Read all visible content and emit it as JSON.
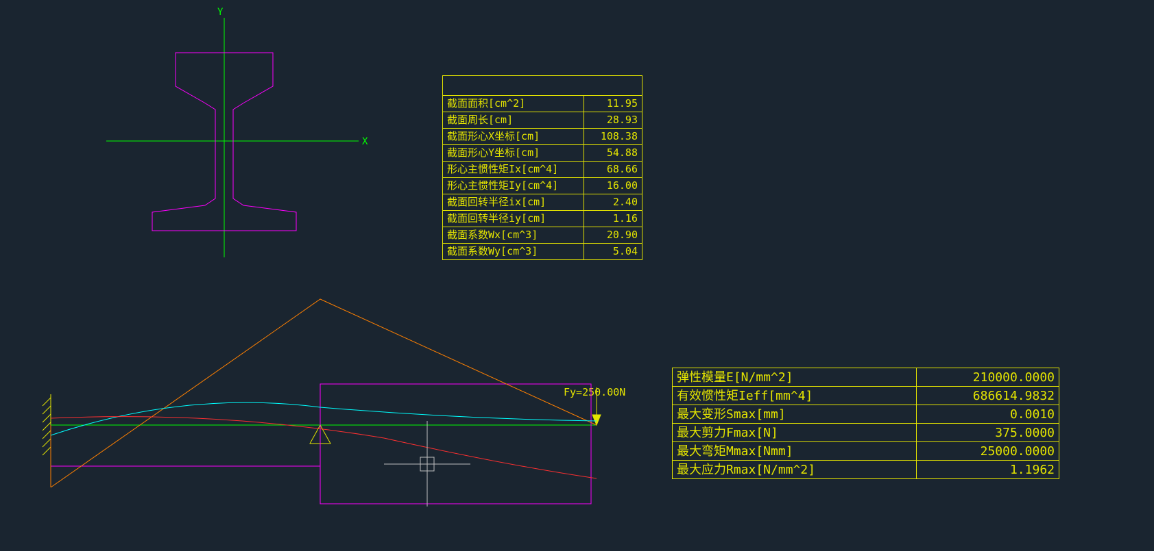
{
  "axes": {
    "x": "X",
    "y": "Y"
  },
  "section_table": {
    "rows": [
      {
        "label": "截面面积[cm^2]",
        "value": "11.95"
      },
      {
        "label": "截面周长[cm]",
        "value": "28.93"
      },
      {
        "label": "截面形心X坐标[cm]",
        "value": "108.38"
      },
      {
        "label": "截面形心Y坐标[cm]",
        "value": "54.88"
      },
      {
        "label": "形心主惯性矩Ix[cm^4]",
        "value": "68.66"
      },
      {
        "label": "形心主惯性矩Iy[cm^4]",
        "value": "16.00"
      },
      {
        "label": "截面回转半径ix[cm]",
        "value": "2.40"
      },
      {
        "label": "截面回转半径iy[cm]",
        "value": "1.16"
      },
      {
        "label": "截面系数Wx[cm^3]",
        "value": "20.90"
      },
      {
        "label": "截面系数Wy[cm^3]",
        "value": "5.04"
      }
    ]
  },
  "results_table": {
    "rows": [
      {
        "label": "弹性模量E[N/mm^2]",
        "value": "210000.0000"
      },
      {
        "label": "有效惯性矩Ieff[mm^4]",
        "value": "686614.9832"
      },
      {
        "label": "最大变形Smax[mm]",
        "value": "0.0010"
      },
      {
        "label": "最大剪力Fmax[N]",
        "value": "375.0000"
      },
      {
        "label": "最大弯矩Mmax[Nmm]",
        "value": "25000.0000"
      },
      {
        "label": "最大应力Rmax[N/mm^2]",
        "value": "1.1962"
      }
    ]
  },
  "beam": {
    "fy_label": "Fy=250.00N"
  },
  "colors": {
    "axis": "#00ff00",
    "section": "#ff00ff",
    "table_border": "#e5e500",
    "moment": "#ff8000",
    "deflection": "#00ffff",
    "shear_curve": "#ff3030",
    "beam_line": "#00ff00",
    "hatch": "#e5e500",
    "cursor": "#bfbfbf"
  }
}
